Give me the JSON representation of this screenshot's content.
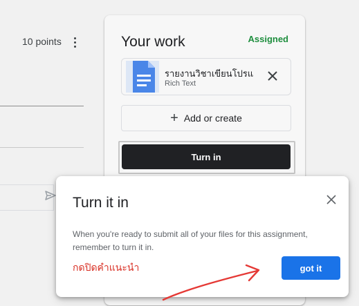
{
  "assignment": {
    "points": "10 points"
  },
  "your_work": {
    "title": "Your work",
    "status": "Assigned",
    "attachment": {
      "name": "รายงานวิชาเขียนโปรแกรม",
      "type": "Rich Text"
    },
    "add_label": "Add or create",
    "turn_in_label": "Turn in"
  },
  "dialog": {
    "title": "Turn it in",
    "body": "When you're ready to submit all of your files for this assignment, remember to turn it in.",
    "annotation": "กดปิดคำแนะนำ",
    "button_label": "got it"
  },
  "colors": {
    "assigned_green": "#1e8e3e",
    "primary_blue": "#1a73e8",
    "annotation_red": "#d93025",
    "turn_in_dark": "#202124"
  }
}
